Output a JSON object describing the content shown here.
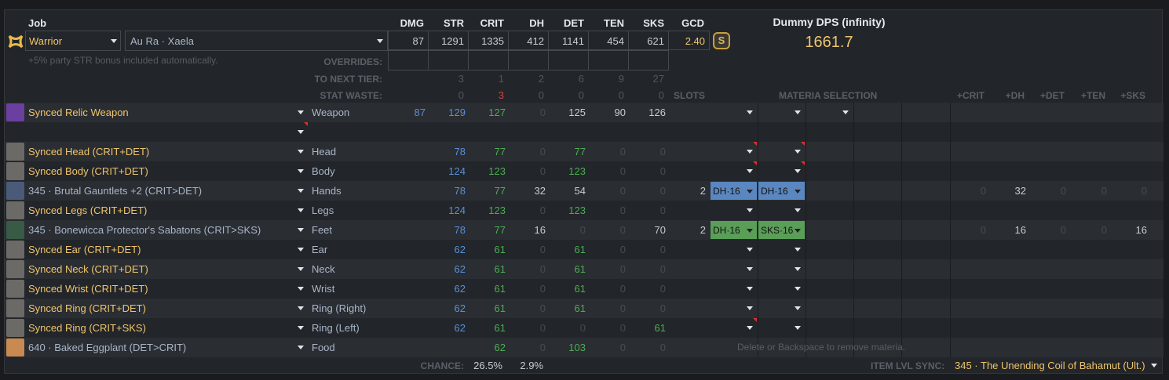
{
  "header": {
    "job_label": "Job",
    "job": "Warrior",
    "race": "Au Ra · Xaela",
    "note": "+5% party STR bonus included automatically.",
    "stat_headers": [
      "DMG",
      "STR",
      "CRIT",
      "DH",
      "DET",
      "TEN",
      "SKS",
      "GCD"
    ],
    "stats": [
      "87",
      "1291",
      "1335",
      "412",
      "1141",
      "454",
      "621"
    ],
    "gcd": "2.40",
    "overrides_label": "OVERRIDES:",
    "next_tier_label": "TO NEXT TIER:",
    "waste_label": "STAT WASTE:",
    "next_tier": [
      "3",
      "1",
      "2",
      "6",
      "9",
      "27"
    ],
    "waste": [
      "0",
      "3",
      "0",
      "0",
      "0",
      "0"
    ],
    "dps_title": "Dummy DPS (infinity)",
    "dps": "1661.7"
  },
  "columns": {
    "slots": "SLOTS",
    "materia": "MATERIA SELECTION",
    "bonus": [
      "+CRIT",
      "+DH",
      "+DET",
      "+TEN",
      "+SKS"
    ]
  },
  "gear": [
    {
      "name": "Synced Relic Weapon",
      "synced": true,
      "slot": "Weapon",
      "icon": "weapon-icon",
      "stats": [
        "87",
        "129",
        "127",
        "0",
        "125",
        "90",
        "126"
      ],
      "tones": "bbgzwww",
      "materia": 3
    },
    {
      "name": "",
      "synced": true,
      "slot": "",
      "icon": "",
      "stats": [
        "",
        "",
        "",
        "",
        "",
        "",
        ""
      ],
      "tones": "zzzzzzz",
      "materia": 0,
      "flag": true
    },
    {
      "name": "Synced Head (CRIT+DET)",
      "synced": true,
      "slot": "Head",
      "icon": "head-icon",
      "stats": [
        "",
        "78",
        "77",
        "0",
        "77",
        "0",
        "0"
      ],
      "tones": "zbgzgzz",
      "materia": 2,
      "flags": [
        1,
        1
      ]
    },
    {
      "name": "Synced Body (CRIT+DET)",
      "synced": true,
      "slot": "Body",
      "icon": "body-icon",
      "stats": [
        "",
        "124",
        "123",
        "0",
        "123",
        "0",
        "0"
      ],
      "tones": "zbgzgzz",
      "materia": 2,
      "flags": [
        1,
        1
      ]
    },
    {
      "name": "345 · Brutal Gauntlets +2 (CRIT>DET)",
      "synced": false,
      "slot": "Hands",
      "icon": "hands-icon",
      "stats": [
        "",
        "78",
        "77",
        "32",
        "54",
        "0",
        "0"
      ],
      "tones": "zbgwwzz",
      "slots": "2",
      "mat": [
        {
          "t": "DH·16",
          "c": "#5b87c0"
        },
        {
          "t": "DH·16",
          "c": "#5b87c0"
        }
      ],
      "bonus": [
        "0",
        "32",
        "0",
        "0",
        "0"
      ]
    },
    {
      "name": "Synced Legs (CRIT+DET)",
      "synced": true,
      "slot": "Legs",
      "icon": "legs-icon",
      "stats": [
        "",
        "124",
        "123",
        "0",
        "123",
        "0",
        "0"
      ],
      "tones": "zbgzgzz",
      "materia": 2
    },
    {
      "name": "345 · Bonewicca Protector's Sabatons (CRIT>SKS)",
      "synced": false,
      "slot": "Feet",
      "icon": "feet-icon",
      "stats": [
        "",
        "78",
        "77",
        "16",
        "0",
        "0",
        "70"
      ],
      "tones": "zbgwzzw",
      "slots": "2",
      "mat": [
        {
          "t": "DH·16",
          "c": "#5a9e58"
        },
        {
          "t": "SKS·16",
          "c": "#5a9e58"
        }
      ],
      "bonus": [
        "0",
        "16",
        "0",
        "0",
        "16"
      ]
    },
    {
      "name": "Synced Ear (CRIT+DET)",
      "synced": true,
      "slot": "Ear",
      "icon": "ear-icon",
      "stats": [
        "",
        "62",
        "61",
        "0",
        "61",
        "0",
        "0"
      ],
      "tones": "zbgzgzz",
      "materia": 2
    },
    {
      "name": "Synced Neck (CRIT+DET)",
      "synced": true,
      "slot": "Neck",
      "icon": "neck-icon",
      "stats": [
        "",
        "62",
        "61",
        "0",
        "61",
        "0",
        "0"
      ],
      "tones": "zbgzgzz",
      "materia": 2
    },
    {
      "name": "Synced Wrist (CRIT+DET)",
      "synced": true,
      "slot": "Wrist",
      "icon": "wrist-icon",
      "stats": [
        "",
        "62",
        "61",
        "0",
        "61",
        "0",
        "0"
      ],
      "tones": "zbgzgzz",
      "materia": 2
    },
    {
      "name": "Synced Ring (CRIT+DET)",
      "synced": true,
      "slot": "Ring (Right)",
      "icon": "ring-icon",
      "stats": [
        "",
        "62",
        "61",
        "0",
        "61",
        "0",
        "0"
      ],
      "tones": "zbgzgzz",
      "materia": 2
    },
    {
      "name": "Synced Ring (CRIT+SKS)",
      "synced": true,
      "slot": "Ring (Left)",
      "icon": "ring-icon",
      "stats": [
        "",
        "62",
        "61",
        "0",
        "0",
        "0",
        "61"
      ],
      "tones": "zbgzzzg",
      "materia": 2,
      "flags": [
        1,
        0
      ]
    },
    {
      "name": "640 · Baked Eggplant (DET>CRIT)",
      "synced": false,
      "slot": "Food",
      "icon": "food-icon",
      "stats": [
        "",
        "",
        "62",
        "0",
        "103",
        "0",
        "0"
      ],
      "tones": "zzgzgzz",
      "materia": 0,
      "hint": "Delete or Backspace to remove materia."
    }
  ],
  "footer": {
    "chance_label": "CHANCE:",
    "crit_chance": "26.5%",
    "dh_chance": "2.9%",
    "sync_label": "ITEM LVL SYNC:",
    "sync_value": "345 · The Unending Coil of Bahamut (Ult.)"
  },
  "colors": {
    "synced_name": "#f0c56c",
    "blue": "#5a8fd8",
    "green": "#4cae52",
    "dps": "#f0c56c"
  }
}
